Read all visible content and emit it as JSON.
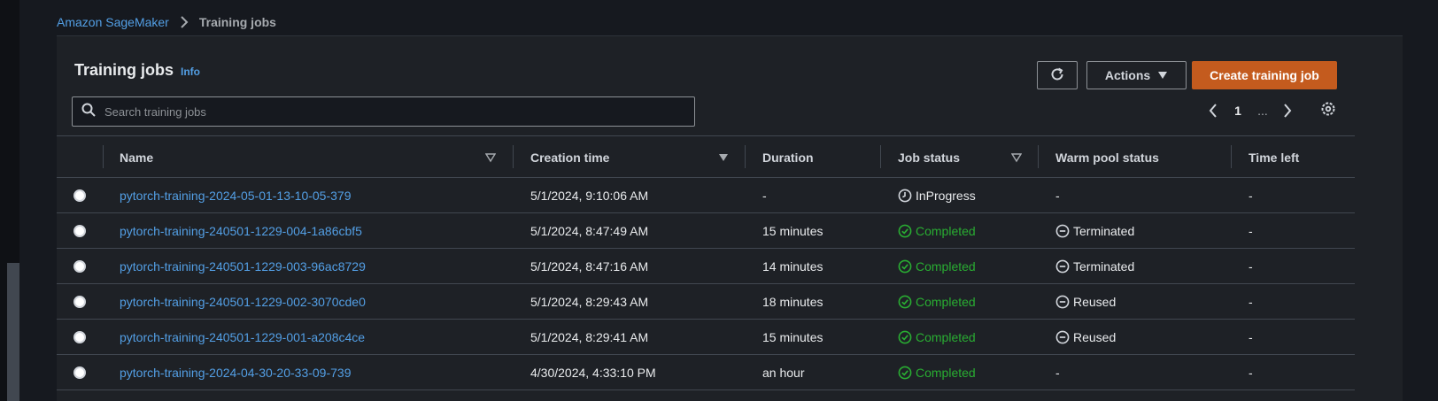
{
  "breadcrumb": {
    "root": "Amazon SageMaker",
    "current": "Training jobs"
  },
  "page": {
    "title": "Training jobs",
    "info_label": "Info"
  },
  "toolbar": {
    "actions_label": "Actions",
    "create_label": "Create training job"
  },
  "search": {
    "placeholder": "Search training jobs",
    "value": ""
  },
  "pagination": {
    "current_page": "1",
    "ellipsis": "..."
  },
  "table": {
    "columns": {
      "name": "Name",
      "creation_time": "Creation time",
      "duration": "Duration",
      "job_status": "Job status",
      "warm_pool_status": "Warm pool status",
      "time_left": "Time left"
    },
    "rows": [
      {
        "name": "pytorch-training-2024-05-01-13-10-05-379",
        "creation_time": "5/1/2024, 9:10:06 AM",
        "duration": "-",
        "job_status": "InProgress",
        "warm_pool_status": "-",
        "time_left": "-"
      },
      {
        "name": "pytorch-training-240501-1229-004-1a86cbf5",
        "creation_time": "5/1/2024, 8:47:49 AM",
        "duration": "15 minutes",
        "job_status": "Completed",
        "warm_pool_status": "Terminated",
        "time_left": "-"
      },
      {
        "name": "pytorch-training-240501-1229-003-96ac8729",
        "creation_time": "5/1/2024, 8:47:16 AM",
        "duration": "14 minutes",
        "job_status": "Completed",
        "warm_pool_status": "Terminated",
        "time_left": "-"
      },
      {
        "name": "pytorch-training-240501-1229-002-3070cde0",
        "creation_time": "5/1/2024, 8:29:43 AM",
        "duration": "18 minutes",
        "job_status": "Completed",
        "warm_pool_status": "Reused",
        "time_left": "-"
      },
      {
        "name": "pytorch-training-240501-1229-001-a208c4ce",
        "creation_time": "5/1/2024, 8:29:41 AM",
        "duration": "15 minutes",
        "job_status": "Completed",
        "warm_pool_status": "Reused",
        "time_left": "-"
      },
      {
        "name": "pytorch-training-2024-04-30-20-33-09-739",
        "creation_time": "4/30/2024, 4:33:10 PM",
        "duration": "an hour",
        "job_status": "Completed",
        "warm_pool_status": "-",
        "time_left": "-"
      }
    ]
  },
  "colors": {
    "background": "#16191f",
    "surface": "#1e2126",
    "link": "#539fe5",
    "primary_button": "#c45b1e",
    "success": "#29ad32"
  }
}
